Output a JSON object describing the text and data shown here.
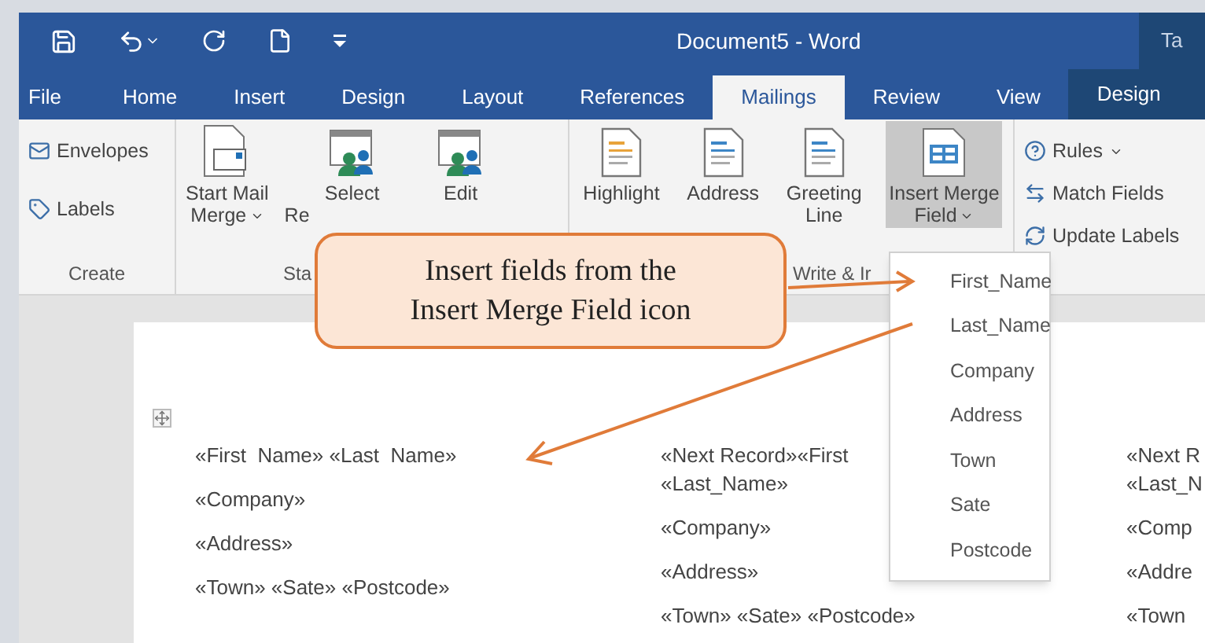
{
  "title_bar": {
    "title": "Document5 - Word",
    "context_label": "Ta"
  },
  "tabs": [
    {
      "label": "File",
      "selected": false,
      "contextual": false
    },
    {
      "label": "Home",
      "selected": false,
      "contextual": false
    },
    {
      "label": "Insert",
      "selected": false,
      "contextual": false
    },
    {
      "label": "Design",
      "selected": false,
      "contextual": false
    },
    {
      "label": "Layout",
      "selected": false,
      "contextual": false
    },
    {
      "label": "References",
      "selected": false,
      "contextual": false
    },
    {
      "label": "Mailings",
      "selected": true,
      "contextual": false
    },
    {
      "label": "Review",
      "selected": false,
      "contextual": false
    },
    {
      "label": "View",
      "selected": false,
      "contextual": false
    },
    {
      "label": "Design",
      "selected": false,
      "contextual": true
    }
  ],
  "ribbon": {
    "groups": [
      {
        "label": "Create",
        "buttons": [
          {
            "kind": "small",
            "lines": [
              "Envelopes"
            ],
            "dropdown": false,
            "pressed": false
          },
          {
            "kind": "small",
            "lines": [
              "Labels"
            ],
            "dropdown": false,
            "pressed": false
          }
        ]
      },
      {
        "label": "Sta",
        "buttons": [
          {
            "kind": "large",
            "lines": [
              "Start Mail",
              "Merge"
            ],
            "dropdown": true,
            "pressed": false
          },
          {
            "kind": "large",
            "lines": [
              "Select",
              "Re"
            ],
            "dropdown": false,
            "pressed": false,
            "clipped": true
          },
          {
            "kind": "large",
            "lines": [
              "Edit"
            ],
            "dropdown": false,
            "pressed": false
          }
        ]
      },
      {
        "label": "Write & Ir",
        "buttons": [
          {
            "kind": "large",
            "lines": [
              "Highlight"
            ],
            "dropdown": false,
            "pressed": false
          },
          {
            "kind": "large",
            "lines": [
              "Address"
            ],
            "dropdown": false,
            "pressed": false
          },
          {
            "kind": "large",
            "lines": [
              "Greeting",
              "Line"
            ],
            "dropdown": false,
            "pressed": false
          },
          {
            "kind": "large",
            "lines": [
              "Insert Merge",
              "Field"
            ],
            "dropdown": true,
            "pressed": true
          }
        ]
      },
      {
        "buttons": [
          {
            "kind": "small",
            "lines": [
              "Rules"
            ],
            "dropdown": true,
            "pressed": false
          },
          {
            "kind": "small",
            "lines": [
              "Match Fields"
            ],
            "dropdown": false,
            "pressed": false
          },
          {
            "kind": "small",
            "lines": [
              "Update Labels"
            ],
            "dropdown": false,
            "pressed": false
          }
        ]
      }
    ]
  },
  "merge_field_menu": {
    "items": [
      "First_Name",
      "Last_Name",
      "Company",
      "Address",
      "Town",
      "Sate",
      "Postcode"
    ]
  },
  "document": {
    "columns": [
      {
        "lines": [
          "«First  Name» «Last  Name»",
          "«Company»",
          "«Address»",
          "«Town» «Sate» «Postcode»"
        ]
      },
      {
        "lines": [
          "«Next Record»«First",
          "«Last_Name»",
          "«Company»",
          "«Address»",
          "«Town» «Sate» «Postcode»"
        ]
      },
      {
        "lines": [
          "«Next R",
          "«Last_N",
          "«Comp",
          "«Addre",
          "«Town"
        ]
      }
    ]
  },
  "callout": {
    "lines": [
      "Insert fields from the",
      "Insert Merge Field icon"
    ]
  }
}
